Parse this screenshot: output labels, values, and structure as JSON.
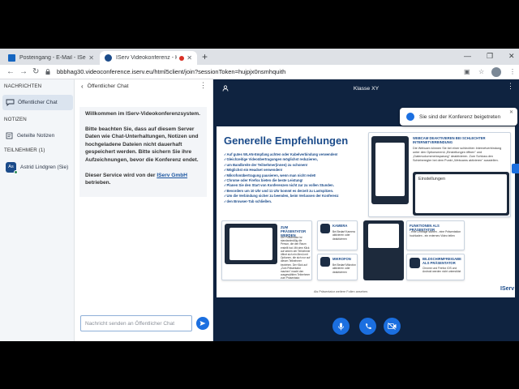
{
  "browser": {
    "tabs": [
      {
        "title": "Posteingang - E-Mail - IServ - ak",
        "active": false,
        "icon": "mail-icon"
      },
      {
        "title": "IServ Videokonferenz - Klass",
        "active": true,
        "icon": "conference-icon",
        "recording": true
      }
    ],
    "url": "bbbhag30.videoconference.iserv.eu/html5client/join?sessionToken=hujpjx0nsmhquith",
    "colors": {
      "tabbar": "#dee1e6",
      "accent": "#1b6fe0"
    }
  },
  "sidebar": {
    "messages_heading": "NACHRICHTEN",
    "public_chat_label": "Öffentlicher Chat",
    "notes_heading": "NOTIZEN",
    "shared_notes_label": "Geteilte Notizen",
    "participants_heading": "TEILNEHMER (1)",
    "participants": [
      {
        "initials": "As",
        "name": "Astrid Lindgren (Sie)"
      }
    ]
  },
  "chat": {
    "title": "Öffentlicher Chat",
    "welcome_paragraphs": [
      "Willkommen im IServ-Videokonferenzsystem.",
      "Bitte beachten Sie, dass auf diesem Server Daten wie Chat-Unterhaltungen, Notizen und hochgeladene Dateien nicht dauerhaft gespeichert werden. Bitte sichern Sie ihre Aufzeichnungen, bevor die Konferenz endet."
    ],
    "service_text": "Dieser Service wird von der ",
    "service_link": "IServ GmbH",
    "service_suffix": " betrieben.",
    "input_placeholder": "Nachricht senden an Öffentlicher Chat"
  },
  "meeting": {
    "title": "Klasse XY",
    "toast": "Sie sind der Konferenz beigetreten",
    "slide": {
      "title": "Generelle Empfehlungen",
      "bullets": [
        "Auf gutes WLAN-Empfang achten oder Kabelverbindung verwenden!",
        "Gleichzeitige Videoübertragungen möglichst reduzieren,",
        "um Bandbreite der Teilnehmer(innen) zu schonen!",
        "Möglichst ein Headset verwenden!",
        "Mikrofonübertragung pausieren, wenn man nicht redet!",
        "Chrome oder Firefox bieten die beste Leistung!",
        "Planen Sie den Start von Konferenzen nicht zur zu vollen Stunden.",
        "Bevorders um 10 Uhr und 11 Uhr kommt es derzeit zu Lastspitzen.",
        "Um die Verbindung sicher zu beenden, beim Verlassen der Konferenz",
        "den Browser-Tab schließen."
      ],
      "webcam_heading": "WEBCAM DEAKTIVIEREN BEI SCHLECHTER INTERNETVERBINDUNG",
      "webcam_body": "Die Webcam können Sie bei einer schlechten Internetverbindung unter den Optionsmenü „Einstellungen öffnen\" und „Datenvolumeneinsparung\" deaktivieren. Zum Schluss den Schieberegler bei dem Punkt „Webcams aktivieren\" ausstellen.",
      "settings_label": "Einstellungen",
      "presenter_heading": "ZUM PRÄSENTATOR WERDEN",
      "presenter_body": "Der Präsentator ist standardmäßig die Person, die den Raum erstellt hat. Mit dem Klick auf seinen der Teilnehmer öffnet sich ein Menü mit Optionen, die sich nur auf diesen Teilnehmer beziehen. Der Klick auf „Zum Präsentator machen\" macht den ausgewählten Teilnehmer zum Präsentator.",
      "camera_heading": "KAMERA",
      "camera_body": "Bei Bedarf Kamera aktivieren oder deaktivieren",
      "mic_heading": "MIKROFON",
      "mic_body": "Bei Bedarf Mikrofon aktivieren oder deaktivieren",
      "functions_heading": "FUNKTIONEN ALS PRÄSENTATOR",
      "functions_body": "- eine Umfrage starten - eine Präsentation hochladen - ein externes Video teilen",
      "screenshare_heading": "BILDSCHIRMFREIGABE ALS PRÄSENTATOR",
      "screenshare_body": "Chrome und Firefox IOS und Android werden nicht unterstützt",
      "footer": "Als Präsentator weitere Folien ansehen.",
      "logo": "IServ"
    }
  }
}
